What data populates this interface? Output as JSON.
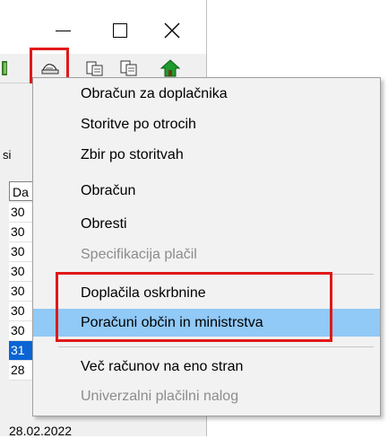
{
  "window": {
    "controls": {
      "minimize": "minimize-icon",
      "maximize": "maximize-icon",
      "close": "close-icon"
    }
  },
  "toolbar": {
    "buttons": [
      "report-icon",
      "print-icon",
      "copy-icon",
      "home-icon"
    ]
  },
  "grid": {
    "stub_label": "si",
    "column_header": "Da",
    "rows": [
      "30",
      "30",
      "30",
      "30",
      "30",
      "30",
      "30",
      "31",
      "28"
    ],
    "selected_index": 7,
    "last_row_partial": "28.02.2022"
  },
  "menu": {
    "items": [
      {
        "label": "Obračun za doplačnika",
        "enabled": true
      },
      {
        "label": "Storitve po otrocih",
        "enabled": true
      },
      {
        "label": "Zbir po storitvah",
        "enabled": true
      },
      {
        "label": "Obračun",
        "enabled": true
      },
      {
        "label": "Obresti",
        "enabled": true
      },
      {
        "label": "Specifikacija plačil",
        "enabled": false
      },
      {
        "label": "Doplačila oskrbnine",
        "enabled": true
      },
      {
        "label": "Poračuni občin in ministrstva",
        "enabled": true,
        "highlighted": true
      },
      {
        "label": "Več računov na eno stran",
        "enabled": true
      },
      {
        "label": "Univerzalni plačilni nalog",
        "enabled": false
      }
    ]
  },
  "colors": {
    "highlight": "#91c9f7",
    "annotation": "#e01818",
    "selected_row": "#0a64d4"
  }
}
